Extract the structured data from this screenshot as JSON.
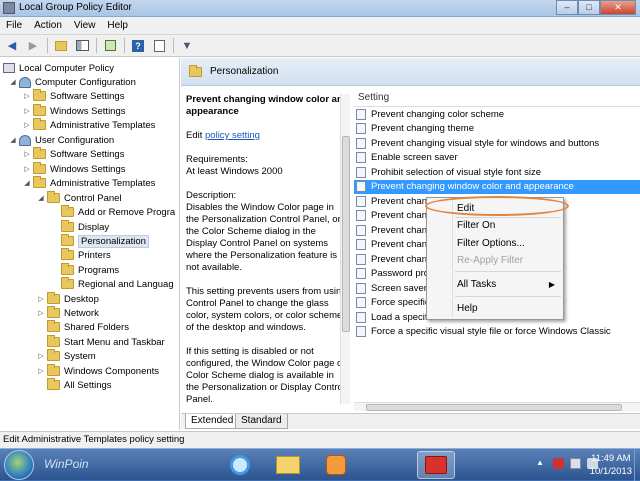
{
  "window": {
    "title": "Local Group Policy Editor",
    "minimize_glyph": "–",
    "maximize_glyph": "□",
    "close_glyph": "✕"
  },
  "menu": [
    "File",
    "Action",
    "View",
    "Help"
  ],
  "toolbar_icons": [
    "back-icon",
    "forward-icon",
    "up-folder-icon",
    "show-hide-tree-icon",
    "export-list-icon",
    "help-icon",
    "properties-icon",
    "filter-icon"
  ],
  "tree": {
    "root": "Local Computer Policy",
    "computer_config": "Computer Configuration",
    "cc_software": "Software Settings",
    "cc_windows": "Windows Settings",
    "cc_admin": "Administrative Templates",
    "user_config": "User Configuration",
    "uc_software": "Software Settings",
    "uc_windows": "Windows Settings",
    "uc_admin": "Administrative Templates",
    "control_panel": "Control Panel",
    "add_remove": "Add or Remove Progra",
    "display": "Display",
    "personalization": "Personalization",
    "printers": "Printers",
    "programs": "Programs",
    "regional": "Regional and Languag",
    "desktop": "Desktop",
    "network": "Network",
    "shared_folders": "Shared Folders",
    "start_menu": "Start Menu and Taskbar",
    "system": "System",
    "windows_components": "Windows Components",
    "all_settings": "All Settings"
  },
  "main": {
    "header": "Personalization",
    "desc_title": "Prevent changing window color and appearance",
    "edit_prefix": "Edit",
    "edit_link": "policy setting",
    "requirements_label": "Requirements:",
    "requirements_value": "At least Windows 2000",
    "description_label": "Description:",
    "description_1": "Disables the Window Color page in the Personalization Control Panel, or the Color Scheme dialog in the Display Control Panel on systems where the Personalization feature is not available.",
    "description_2": "This setting prevents users from using Control Panel to change the glass color, system colors, or color scheme of the desktop and windows.",
    "description_3": "If this setting is disabled or not configured, the Window Color page or Color Scheme dialog is available in the Personalization or Display Control Panel.",
    "column_header": "Setting",
    "settings": [
      "Prevent changing color scheme",
      "Prevent changing theme",
      "Prevent changing visual style for windows and buttons",
      "Enable screen saver",
      "Prohibit selection of visual style font size",
      "Prevent changing window color and appearance",
      "Prevent changi",
      "Prevent chang",
      "Prevent chang",
      "Prevent chang",
      "Prevent chang",
      "Password prot",
      "Screen saver ti",
      "Force specific",
      "Load a specific theme",
      "Force a specific visual style file or force Windows Classic"
    ],
    "tabs": [
      "Extended",
      "Standard"
    ]
  },
  "context_menu": {
    "edit": "Edit",
    "filter_on": "Filter On",
    "filter_options": "Filter Options...",
    "reapply_filter": "Re-Apply Filter",
    "all_tasks": "All Tasks",
    "all_tasks_arrow": "▶",
    "help": "Help"
  },
  "statusbar": "Edit Administrative Templates policy setting",
  "taskbar": {
    "watermark": "WinPoin",
    "apps": [
      "internet-explorer-icon",
      "explorer-icon",
      "media-player-icon",
      "group-policy-icon"
    ],
    "time": "11:49 AM",
    "date": "10/1/2013"
  },
  "colors": {
    "selection": "#3399ff",
    "highlight_ring": "#e2843c",
    "taskbar": "#2c5591"
  }
}
